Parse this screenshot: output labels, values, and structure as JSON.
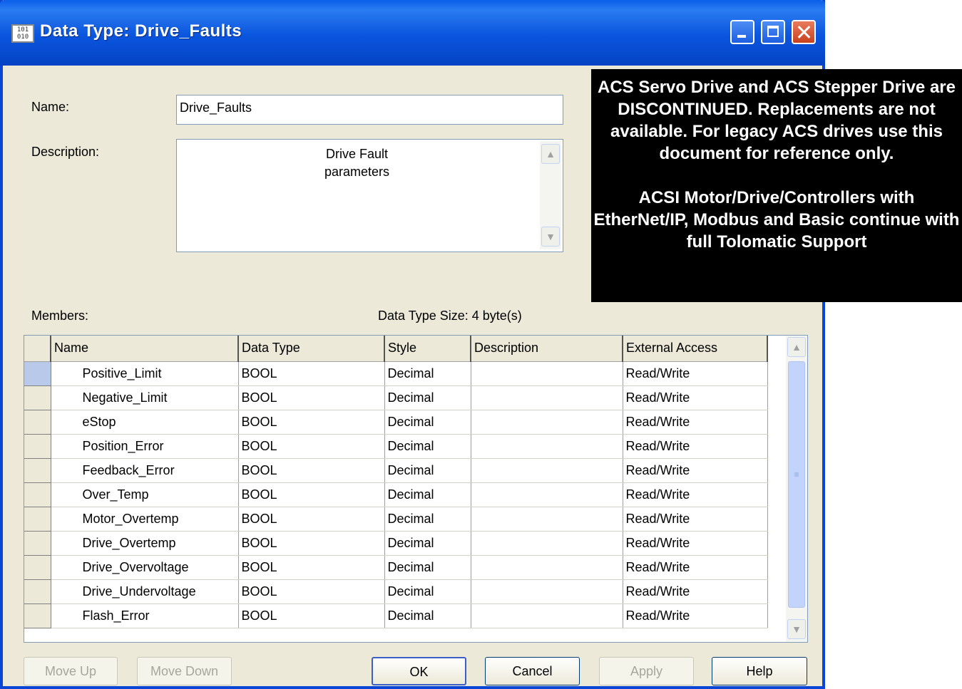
{
  "window": {
    "title": "Data Type:  Drive_Faults",
    "icon_text": "101\n010"
  },
  "form": {
    "name_label": "Name:",
    "name_value": "Drive_Faults",
    "description_label": "Description:",
    "description_value": "Drive Fault\nparameters",
    "members_label": "Members:",
    "data_type_size": "Data Type Size: 4 byte(s)"
  },
  "grid": {
    "columns": [
      "Name",
      "Data Type",
      "Style",
      "Description",
      "External Access"
    ],
    "rows": [
      {
        "name": "Positive_Limit",
        "type": "BOOL",
        "style": "Decimal",
        "description": "",
        "access": "Read/Write"
      },
      {
        "name": "Negative_Limit",
        "type": "BOOL",
        "style": "Decimal",
        "description": "",
        "access": "Read/Write"
      },
      {
        "name": "eStop",
        "type": "BOOL",
        "style": "Decimal",
        "description": "",
        "access": "Read/Write"
      },
      {
        "name": "Position_Error",
        "type": "BOOL",
        "style": "Decimal",
        "description": "",
        "access": "Read/Write"
      },
      {
        "name": "Feedback_Error",
        "type": "BOOL",
        "style": "Decimal",
        "description": "",
        "access": "Read/Write"
      },
      {
        "name": "Over_Temp",
        "type": "BOOL",
        "style": "Decimal",
        "description": "",
        "access": "Read/Write"
      },
      {
        "name": "Motor_Overtemp",
        "type": "BOOL",
        "style": "Decimal",
        "description": "",
        "access": "Read/Write"
      },
      {
        "name": "Drive_Overtemp",
        "type": "BOOL",
        "style": "Decimal",
        "description": "",
        "access": "Read/Write"
      },
      {
        "name": "Drive_Overvoltage",
        "type": "BOOL",
        "style": "Decimal",
        "description": "",
        "access": "Read/Write"
      },
      {
        "name": "Drive_Undervoltage",
        "type": "BOOL",
        "style": "Decimal",
        "description": "",
        "access": "Read/Write"
      },
      {
        "name": "Flash_Error",
        "type": "BOOL",
        "style": "Decimal",
        "description": "",
        "access": "Read/Write"
      }
    ]
  },
  "buttons": {
    "move_up": "Move Up",
    "move_down": "Move Down",
    "ok": "OK",
    "cancel": "Cancel",
    "apply": "Apply",
    "help": "Help"
  },
  "notice": {
    "paragraph1": "ACS Servo Drive and ACS Stepper Drive are DISCONTINUED. Replacements are not available. For legacy ACS drives use this document for reference only.",
    "paragraph2": "ACSI Motor/Drive/Controllers with EtherNet/IP, Modbus and Basic continue with full Tolomatic Support"
  },
  "icons": [
    "datatype-icon",
    "minimize-icon",
    "maximize-icon",
    "close-icon",
    "scroll-up-icon",
    "scroll-down-icon",
    "scroll-grip-icon"
  ],
  "colors": {
    "titlebar": "#0a55dd",
    "dialog_bg": "#ece9d8",
    "selected_row_header": "#b8c9ea",
    "notice_bg": "#000000",
    "notice_text": "#ffffff"
  }
}
